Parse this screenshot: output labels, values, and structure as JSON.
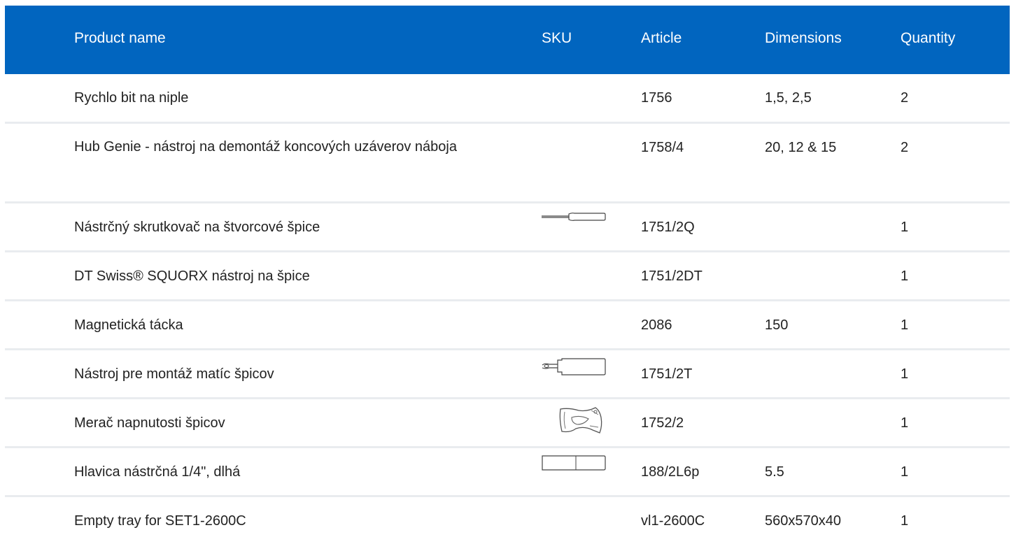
{
  "headers": {
    "product_name": "Product name",
    "sku": "SKU",
    "article": "Article",
    "dimensions": "Dimensions",
    "quantity": "Quantity"
  },
  "rows": [
    {
      "name": "Rychlo bit na niple",
      "sku_icon": "",
      "article": "1756",
      "dimensions": "1,5, 2,5",
      "quantity": "2"
    },
    {
      "name": "Hub Genie - nástroj na demontáž koncových uzáverov náboja",
      "sku_icon": "",
      "article": "1758/4",
      "dimensions": "20, 12 & 15",
      "quantity": "2"
    },
    {
      "name": "Nástrčný skrutkovač na štvorcové špice",
      "sku_icon": "screwdriver-icon",
      "article": "1751/2Q",
      "dimensions": "",
      "quantity": "1"
    },
    {
      "name": "DT Swiss® SQUORX nástroj na špice",
      "sku_icon": "",
      "article": "1751/2DT",
      "dimensions": "",
      "quantity": "1"
    },
    {
      "name": "Magnetická tácka",
      "sku_icon": "",
      "article": "2086",
      "dimensions": "150",
      "quantity": "1"
    },
    {
      "name": "Nástroj pre montáž matíc špicov",
      "sku_icon": "nipple-tool-icon",
      "article": "1751/2T",
      "dimensions": "",
      "quantity": "1"
    },
    {
      "name": "Merač napnutosti špicov",
      "sku_icon": "tension-meter-icon",
      "article": "1752/2",
      "dimensions": "",
      "quantity": "1"
    },
    {
      "name": "Hlavica nástrčná 1/4\", dlhá",
      "sku_icon": "socket-icon",
      "article": "188/2L6p",
      "dimensions": "5.5",
      "quantity": "1"
    },
    {
      "name": "Empty tray for SET1-2600C",
      "sku_icon": "",
      "article": "vl1-2600C",
      "dimensions": "560x570x40",
      "quantity": "1"
    }
  ]
}
